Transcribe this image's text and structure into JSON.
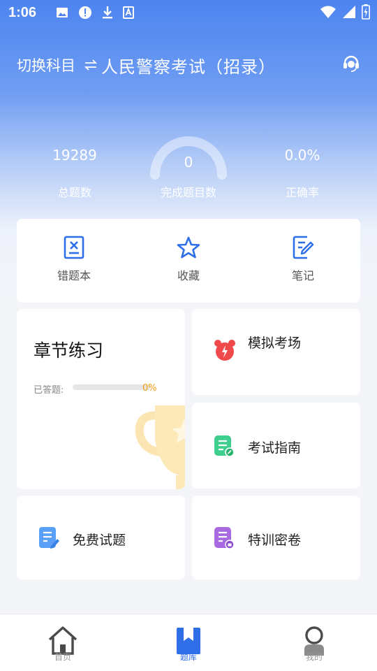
{
  "status_bar": {
    "time": "1:06",
    "icons": [
      "image-icon",
      "alert-icon",
      "download-icon",
      "text-icon",
      "wifi-icon",
      "signal-icon",
      "battery-icon"
    ]
  },
  "header": {
    "switch_label": "切换科目",
    "switch_icon": "swap-icon",
    "title": "人民警察考试（招录）",
    "support_icon": "headset-icon"
  },
  "stats": {
    "total_value": "19289",
    "total_label": "总题数",
    "done_value": "0",
    "done_label": "完成题目数",
    "accuracy_value": "0.0%",
    "accuracy_label": "正确率"
  },
  "quick_actions": [
    {
      "label": "错题本",
      "icon": "wrong-book-icon"
    },
    {
      "label": "收藏",
      "icon": "star-icon"
    },
    {
      "label": "笔记",
      "icon": "note-edit-icon"
    }
  ],
  "chapter": {
    "title": "章节练习",
    "answered_label": "已答题:",
    "progress": 0,
    "progress_text": "0%",
    "icon": "trophy-icon"
  },
  "modules": {
    "mock": {
      "label": "模拟考场",
      "icon": "alarm-clock-icon",
      "color": "#f0494c"
    },
    "guide": {
      "label": "考试指南",
      "icon": "guide-doc-icon",
      "color": "#3ecf8e"
    },
    "free": {
      "label": "免费试题",
      "icon": "free-doc-icon",
      "color": "#5aa0f7"
    },
    "secret": {
      "label": "特训密卷",
      "icon": "secret-doc-icon",
      "color": "#a86ae0"
    }
  },
  "tabs": [
    {
      "label": "首页",
      "icon": "home-icon",
      "active": false
    },
    {
      "label": "题库",
      "icon": "bookmark-icon",
      "active": true
    },
    {
      "label": "我的",
      "icon": "profile-icon",
      "active": false
    }
  ],
  "colors": {
    "accent": "#2e6fe8",
    "progress_text": "#f39c12"
  }
}
